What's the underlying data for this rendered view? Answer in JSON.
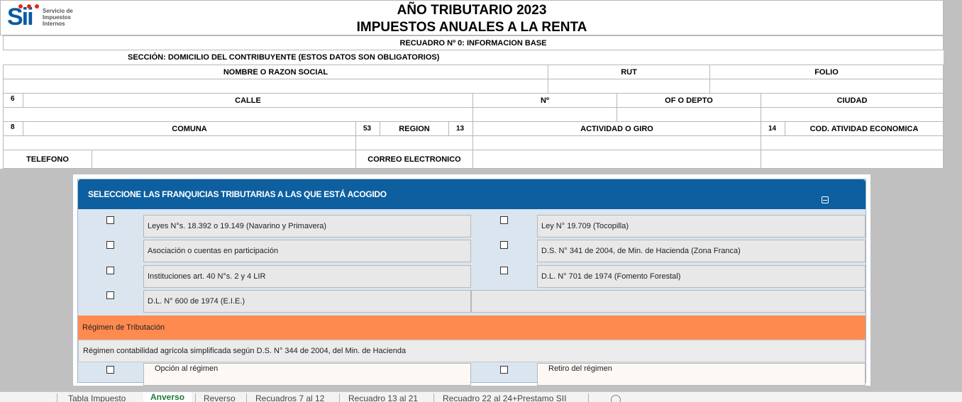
{
  "header": {
    "logo_name": "SII",
    "logo_text_1": "Servicio de",
    "logo_text_2": "Impuestos",
    "logo_text_3": "Internos",
    "title_line1": "AÑO  TRIBUTARIO  2023",
    "title_line2": "IMPUESTOS ANUALES A LA RENTA",
    "recuadro": "RECUADRO Nº 0: INFORMACION BASE",
    "seccion": "SECCIÓN: DOMICILIO DEL CONTRIBUYENTE (ESTOS DATOS SON OBLIGATORIOS)"
  },
  "form": {
    "nombre": "NOMBRE O RAZON SOCIAL",
    "rut": "RUT",
    "folio": "FOLIO",
    "code6": "6",
    "calle": "CALLE",
    "numero": "Nº",
    "depto": "OF O DEPTO",
    "ciudad": "CIUDAD",
    "code8": "8",
    "comuna": "COMUNA",
    "code53": "53",
    "region": "REGION",
    "code13": "13",
    "actividad": "ACTIVIDAD O GIRO",
    "code14": "14",
    "cod_actividad": "COD. ATIVIDAD ECONOMICA",
    "telefono": "TELEFONO",
    "correo": "CORREO ELECTRONICO"
  },
  "panel": {
    "title": "SELECCIONE LAS FRANQUICIAS TRIBUTARIAS A LAS QUE ESTÁ ACOGIDO",
    "options": [
      "Leyes N°s. 18.392 o 19.149 (Navarino y Primavera)",
      "Ley N° 19.709 (Tocopilla)",
      "Asociación o cuentas en participación",
      "D.S. N° 341 de 2004, de Min. de Hacienda (Zona Franca)",
      "Instituciones art. 40 N°s. 2 y 4 LIR",
      "D.L. N° 701 de 1974 (Fomento Forestal)",
      "D.L. N° 600 de 1974 (E.I.E.)"
    ],
    "regimen_title": "Régimen de Tributación",
    "regimen_text": "Régimen contabilidad agrícola simplificada según D.S. N° 344 de 2004, del Min. de Hacienda",
    "opcion": "Opción al régimen",
    "retiro": "Retiro del régimen"
  },
  "tabs": [
    "Tabla Impuesto",
    "Anverso",
    "Reverso",
    "Recuadros 7 al 12",
    "Recuadro 13 al 21",
    "Recuadro 22 al 24+Prestamo SII"
  ],
  "active_tab": "Anverso",
  "colors": {
    "panel_header": "#0d5f9f",
    "regimen": "#ff8a50",
    "logo_blue": "#0a5aa5",
    "logo_red": "#e0291b",
    "active_tab": "#1a7a3a"
  }
}
